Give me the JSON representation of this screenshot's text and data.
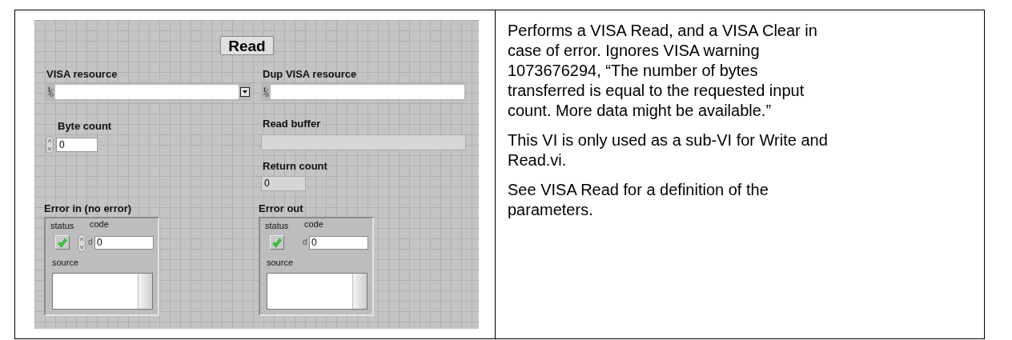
{
  "front_panel": {
    "button": {
      "label": "Read"
    },
    "visa_resource": {
      "label": "VISA resource"
    },
    "dup_visa_resource": {
      "label": "Dup VISA resource"
    },
    "byte_count": {
      "label": "Byte count",
      "value": "0"
    },
    "read_buffer": {
      "label": "Read buffer"
    },
    "return_count": {
      "label": "Return count",
      "value": "0"
    },
    "error_in": {
      "label": "Error in (no error)",
      "status_label": "status",
      "status": true,
      "code_label": "code",
      "radix": "d",
      "code": "0",
      "source_label": "source",
      "spinner": true
    },
    "error_out": {
      "label": "Error out",
      "status_label": "status",
      "status": true,
      "code_label": "code",
      "radix": "d",
      "code": "0",
      "source_label": "source",
      "spinner": false
    }
  },
  "description": {
    "paragraphs": [
      "Performs a VISA Read, and a VISA Clear in case of error. Ignores VISA warning 1073676294, “The number of bytes transferred is equal to the requested input count. More data might be available.”",
      "This VI is only used as a sub-VI for Write and Read.vi.",
      "See VISA Read for a definition of the parameters."
    ]
  }
}
